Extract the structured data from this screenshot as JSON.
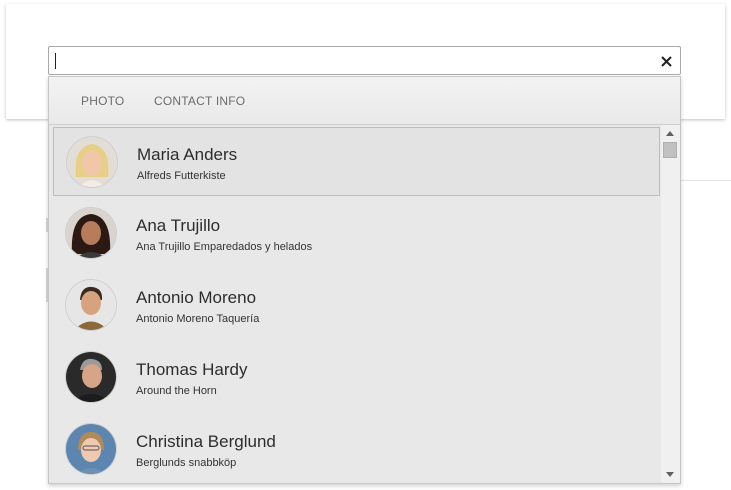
{
  "search": {
    "value": "",
    "placeholder": ""
  },
  "clear_button": {
    "label": "×"
  },
  "header": {
    "photo_label": "PHOTO",
    "contact_label": "CONTACT INFO"
  },
  "contacts": [
    {
      "name": "Maria Anders",
      "company": "Alfreds Futterkiste",
      "selected": true
    },
    {
      "name": "Ana Trujillo",
      "company": "Ana Trujillo Emparedados y helados",
      "selected": false
    },
    {
      "name": "Antonio Moreno",
      "company": "Antonio Moreno Taquería",
      "selected": false
    },
    {
      "name": "Thomas Hardy",
      "company": "Around the Horn",
      "selected": false
    },
    {
      "name": "Christina Berglund",
      "company": "Berglunds snabbköp",
      "selected": false
    }
  ],
  "colors": {
    "selected_bg": "#e3e3e3",
    "list_bg": "#e8e8e8",
    "border": "#a9a9a9"
  }
}
